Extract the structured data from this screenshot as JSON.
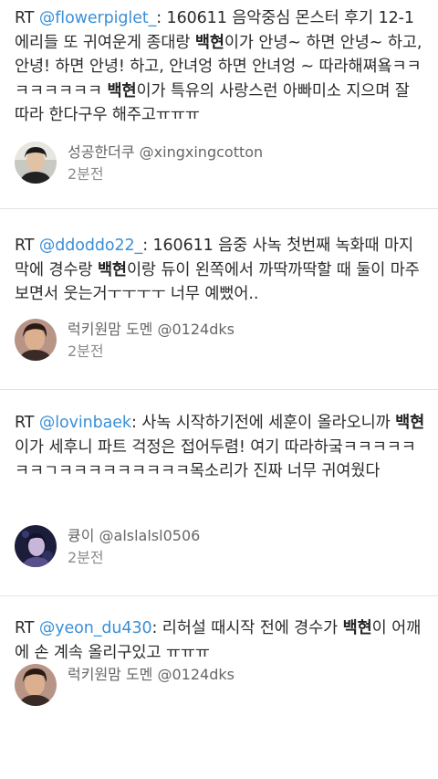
{
  "tweets": [
    {
      "segments": [
        {
          "t": "RT ",
          "s": ""
        },
        {
          "t": "@flowerpiglet_",
          "s": "mention"
        },
        {
          "t": ": 160611 음악중심 몬스터 후기 12-1 에리들 또 귀여운게 종대랑 ",
          "s": ""
        },
        {
          "t": "백현",
          "s": "hl"
        },
        {
          "t": "이가 안녕~ 하면 안녕~ 하고, 안녕! 하면 안녕! 하고, 안녀엉 하면 안녀엉 ~ 따라해쪄욬ㅋㅋㅋㅋㅋㅋㅋㅋ ",
          "s": ""
        },
        {
          "t": "백현",
          "s": "hl"
        },
        {
          "t": "이가 특유의 사랑스런 아빠미소 지으며 잘 따라 한다구우 해주고ㅠㅠㅠ",
          "s": ""
        }
      ],
      "author": "성공한더쿠 @xingxingcotton",
      "time": "2분전",
      "avatar": "man-portrait"
    },
    {
      "segments": [
        {
          "t": "RT ",
          "s": ""
        },
        {
          "t": "@ddoddo22_",
          "s": "mention"
        },
        {
          "t": ": 160611 음중 사녹 첫번째 녹화때 마지막에 경수랑 ",
          "s": ""
        },
        {
          "t": "백현",
          "s": "hl"
        },
        {
          "t": "이랑 듀이 왼쪽에서 까딱까딱할 때 둘이 마주보면서 웃는거ㅜㅜㅜㅜ 너무 예뻤어..",
          "s": ""
        }
      ],
      "author": "럭키원맘 도멘 @0124dks",
      "time": "2분전",
      "avatar": "man-portrait-2"
    },
    {
      "segments": [
        {
          "t": "RT ",
          "s": ""
        },
        {
          "t": "@lovinbaek",
          "s": "mention"
        },
        {
          "t": ": 사녹 시작하기전에 세훈이 올라오니까 ",
          "s": ""
        },
        {
          "t": "백현",
          "s": "hl"
        },
        {
          "t": "이가 세후니 파트 걱정은 접어두렴! 여기 따라하궄ㅋㅋㅋㅋㅋㅋㅋㄱㅋㅋㅋㅋㅋㅋㅋㅋㅋ목소리가 진짜 너무 귀여웠다",
          "s": ""
        }
      ],
      "author": "큥이 @alslalsl0506",
      "time": "2분전",
      "avatar": "dark-portrait"
    },
    {
      "segments": [
        {
          "t": "RT ",
          "s": ""
        },
        {
          "t": "@yeon_du430",
          "s": "mention"
        },
        {
          "t": ": 리허설 때시작 전에 경수가 ",
          "s": ""
        },
        {
          "t": "백현",
          "s": "hl"
        },
        {
          "t": "이 어깨에 손 계속 올리구있고 ㅠㅠㅠ",
          "s": ""
        }
      ],
      "author": "럭키원맘 도멘 @0124dks",
      "time": "",
      "avatar": "man-portrait-2"
    }
  ]
}
